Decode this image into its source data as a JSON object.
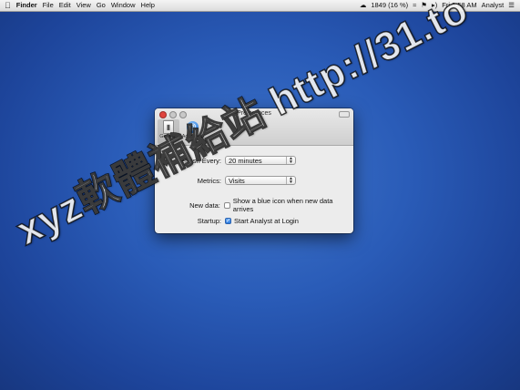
{
  "menubar": {
    "apple_icon": "apple-logo",
    "items": [
      "Finder",
      "File",
      "Edit",
      "View",
      "Go",
      "Window",
      "Help"
    ],
    "status": {
      "battery": "1849 (16 %)",
      "clock": "Fri 9:58 AM",
      "app_name": "Analyst",
      "icons": [
        "cloud-icon",
        "wifi-icon",
        "flag-icon",
        "volume-icon",
        "menu-list-icon"
      ]
    }
  },
  "window": {
    "title": "Preferences",
    "toolbar": [
      {
        "label": "General",
        "icon": "general-switch-icon",
        "selected": true
      },
      {
        "label": "Accounts",
        "icon": "at-sign-icon",
        "selected": false
      }
    ],
    "refresh_label": "Refresh Every:",
    "refresh_value": "20 minutes",
    "metrics_label": "Metrics:",
    "metrics_value": "Visits",
    "new_data_label": "New data:",
    "new_data_checkbox": "Show a blue icon when new data arrives",
    "startup_label": "Startup:",
    "startup_checkbox": "Start Analyst at Login",
    "startup_checked": true
  },
  "watermark": "xyz軟體補給站 http://31.to"
}
